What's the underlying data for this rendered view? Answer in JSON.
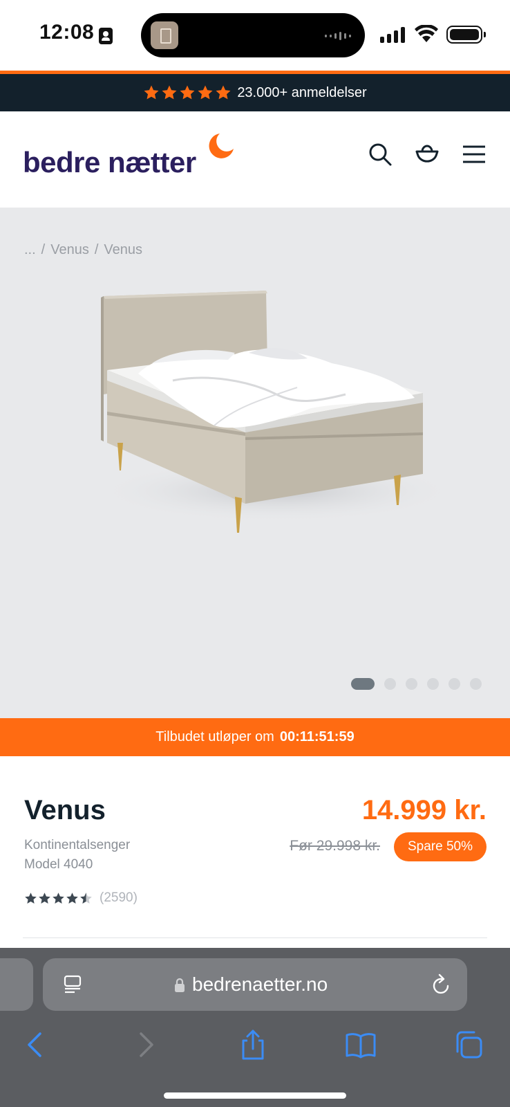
{
  "status_bar": {
    "time": "12:08"
  },
  "reviews_banner": {
    "text": "23.000+ anmeldelser",
    "star_color": "#ff6b12"
  },
  "header": {
    "logo": "bedre nætter",
    "icons": [
      "search-icon",
      "basket-icon",
      "menu-icon"
    ]
  },
  "gallery": {
    "breadcrumb": [
      "...",
      "/",
      "Venus",
      "/",
      "Venus"
    ],
    "slides_total": 6,
    "active_slide": 1,
    "image": "bed-image"
  },
  "countdown": {
    "label": "Tilbudet utløper om",
    "time": "00:11:51:59"
  },
  "product": {
    "name": "Venus",
    "category": "Kontinentalsenger",
    "model": "Model 4040",
    "rating": 4.5,
    "review_count": "(2590)",
    "price": "14.999 kr.",
    "old_price": "Før 29.998 kr.",
    "save_badge": "Spare 50%"
  },
  "browser": {
    "url": "bedrenaetter.no",
    "toolbar": [
      "back-icon",
      "forward-icon",
      "share-icon",
      "bookmarks-icon",
      "tabs-icon"
    ]
  },
  "colors": {
    "accent": "#ff6b12",
    "dark": "#13212c",
    "logo": "#2b1f5e"
  }
}
